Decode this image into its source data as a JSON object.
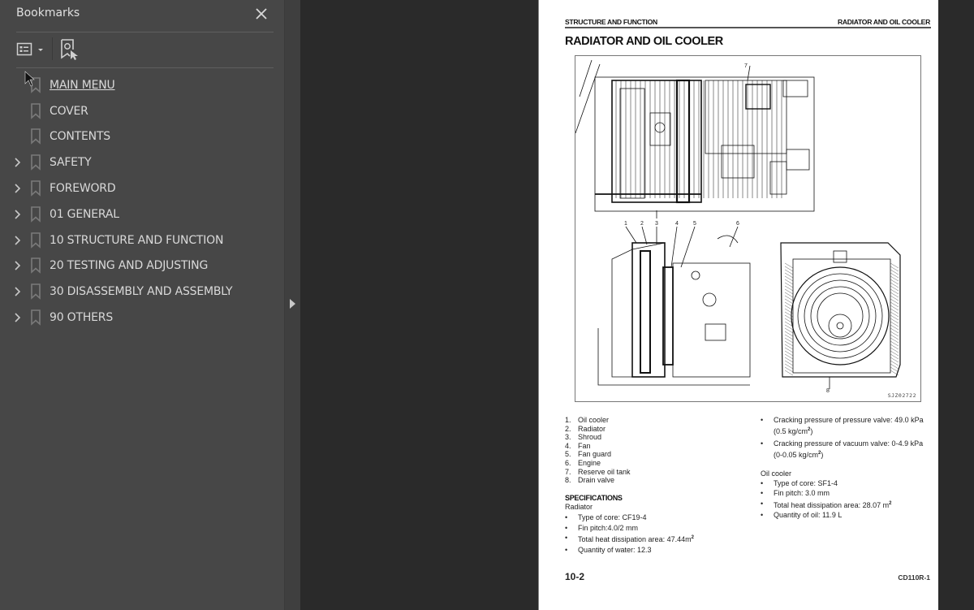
{
  "bookmarks_panel": {
    "title": "Bookmarks",
    "close_icon": "close-icon",
    "toolbar": {
      "options_icon": "list-options-icon",
      "find_icon": "find-current-bookmark-icon"
    },
    "items": [
      {
        "label": "MAIN MENU",
        "expandable": false,
        "link": true
      },
      {
        "label": "COVER",
        "expandable": false,
        "link": false
      },
      {
        "label": "CONTENTS",
        "expandable": false,
        "link": false
      },
      {
        "label": "SAFETY",
        "expandable": true,
        "link": false
      },
      {
        "label": "FOREWORD",
        "expandable": true,
        "link": false
      },
      {
        "label": "01 GENERAL",
        "expandable": true,
        "link": false
      },
      {
        "label": "10 STRUCTURE AND FUNCTION",
        "expandable": true,
        "link": false
      },
      {
        "label": "20 TESTING AND ADJUSTING",
        "expandable": true,
        "link": false
      },
      {
        "label": "30 DISASSEMBLY AND ASSEMBLY",
        "expandable": true,
        "link": false
      },
      {
        "label": "90 OTHERS",
        "expandable": true,
        "link": false
      }
    ]
  },
  "document": {
    "running_header_left": "STRUCTURE AND FUNCTION",
    "running_header_right": "RADIATOR AND OIL COOLER",
    "title": "RADIATOR AND OIL COOLER",
    "figure": {
      "code": "SJZ02722",
      "callouts": [
        "1",
        "2",
        "3",
        "4",
        "5",
        "6",
        "7",
        "8"
      ]
    },
    "legend": [
      {
        "num": "1.",
        "text": "Oil cooler"
      },
      {
        "num": "2.",
        "text": "Radiator"
      },
      {
        "num": "3.",
        "text": "Shroud"
      },
      {
        "num": "4.",
        "text": "Fan"
      },
      {
        "num": "5.",
        "text": "Fan guard"
      },
      {
        "num": "6.",
        "text": "Engine"
      },
      {
        "num": "7.",
        "text": "Reserve oil tank"
      },
      {
        "num": "8.",
        "text": "Drain valve"
      }
    ],
    "specifications_heading": "SPECIFICATIONS",
    "radiator": {
      "heading": "Radiator",
      "bullets": [
        "Type of core: CF19-4",
        "Fin pitch:4.0/2 mm",
        "Total heat dissipation area: 47.44m",
        "Quantity of water: 12.3"
      ],
      "more_bullets": [
        {
          "line1": "Cracking pressure of pressure valve: 49.0 kPa",
          "line2": "(0.5 kg/cm",
          "line2_end": ")"
        },
        {
          "line1": "Cracking pressure of vacuum valve: 0-4.9 kPa",
          "line2": "(0-0.05 kg/cm",
          "line2_end": ")"
        }
      ]
    },
    "oil_cooler": {
      "heading": "Oil cooler",
      "bullets": [
        "Type of core: SF1-4",
        "Fin pitch: 3.0 mm",
        "Total heat dissipation area: 28.07 m",
        "Quantity of oil: 11.9 L"
      ]
    },
    "superscript": "2",
    "page_number": "10-2",
    "model": "CD110R-1"
  }
}
